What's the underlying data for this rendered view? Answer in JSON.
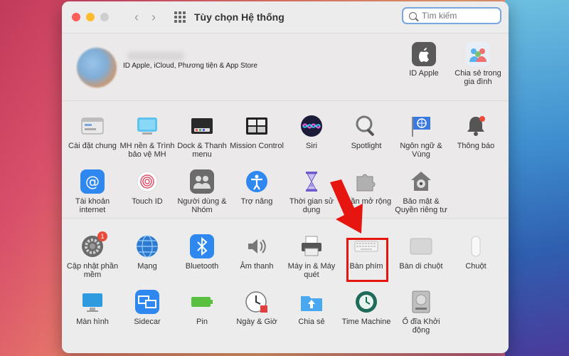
{
  "window": {
    "title": "Tùy chọn Hệ thống",
    "search_placeholder": "Tìm kiếm"
  },
  "account": {
    "label": "ID Apple, iCloud, Phương tiện & App Store",
    "items": [
      {
        "label": "ID Apple",
        "icon": "apple-logo-icon"
      },
      {
        "label": "Chia sẻ trong gia đình",
        "icon": "family-sharing-icon"
      }
    ]
  },
  "row1": [
    {
      "label": "Cài đặt chung",
      "icon": "general-icon"
    },
    {
      "label": "MH nền & Trình bảo vệ MH",
      "icon": "desktop-screensaver-icon"
    },
    {
      "label": "Dock & Thanh menu",
      "icon": "dock-icon"
    },
    {
      "label": "Mission Control",
      "icon": "mission-control-icon"
    },
    {
      "label": "Siri",
      "icon": "siri-icon"
    },
    {
      "label": "Spotlight",
      "icon": "spotlight-icon"
    },
    {
      "label": "Ngôn ngữ & Vùng",
      "icon": "language-region-icon"
    },
    {
      "label": "Thông báo",
      "icon": "notifications-icon"
    }
  ],
  "row2": [
    {
      "label": "Tài khoản internet",
      "icon": "internet-accounts-icon"
    },
    {
      "label": "Touch ID",
      "icon": "touch-id-icon"
    },
    {
      "label": "Người dùng & Nhóm",
      "icon": "users-groups-icon"
    },
    {
      "label": "Trợ năng",
      "icon": "accessibility-icon"
    },
    {
      "label": "Thời gian sử dụng",
      "icon": "screen-time-icon"
    },
    {
      "label": "Phần mở rộng",
      "icon": "extensions-icon"
    },
    {
      "label": "Bảo mật & Quyền riêng tư",
      "icon": "security-privacy-icon"
    }
  ],
  "row3": [
    {
      "label": "Cập nhật phần mềm",
      "icon": "software-update-icon",
      "badge": "1"
    },
    {
      "label": "Mạng",
      "icon": "network-icon"
    },
    {
      "label": "Bluetooth",
      "icon": "bluetooth-icon"
    },
    {
      "label": "Âm thanh",
      "icon": "sound-icon"
    },
    {
      "label": "Máy in & Máy quét",
      "icon": "printers-scanners-icon"
    },
    {
      "label": "Bàn phím",
      "icon": "keyboard-icon",
      "highlighted": true
    },
    {
      "label": "Bàn di chuột",
      "icon": "trackpad-icon"
    },
    {
      "label": "Chuột",
      "icon": "mouse-icon"
    }
  ],
  "row4": [
    {
      "label": "Màn hình",
      "icon": "displays-icon"
    },
    {
      "label": "Sidecar",
      "icon": "sidecar-icon"
    },
    {
      "label": "Pin",
      "icon": "battery-icon"
    },
    {
      "label": "Ngày & Giờ",
      "icon": "date-time-icon"
    },
    {
      "label": "Chia sẻ",
      "icon": "sharing-icon"
    },
    {
      "label": "Time Machine",
      "icon": "time-machine-icon"
    },
    {
      "label": "Ổ đĩa Khởi động",
      "icon": "startup-disk-icon"
    }
  ],
  "colors": {
    "highlight": "#e6150f",
    "accent": "#7aa6e0"
  }
}
